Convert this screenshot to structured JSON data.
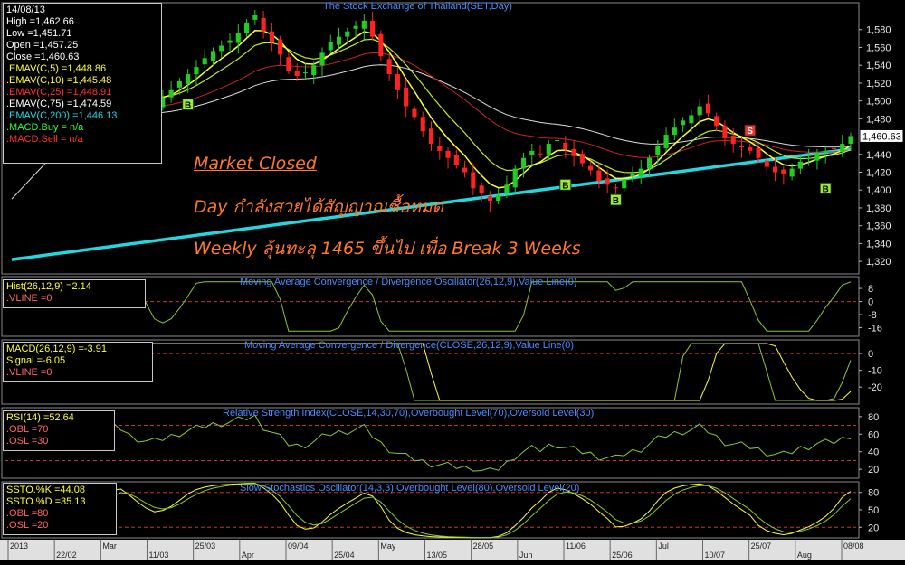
{
  "colors": {
    "bg": "#000000",
    "candle_up": "#22cc22",
    "candle_down": "#ff2222",
    "ema5": "#ffff33",
    "ema10": "#bbee33",
    "ema25": "#cc2222",
    "ema75": "#dddddd",
    "ema200": "#22d8e0",
    "title": "#4a8dff",
    "annotation": "#ff7a2a",
    "dashed_level": "#cc3333"
  },
  "price_info": {
    "date": "14/08/13",
    "high": "High  =1,462.66",
    "low": "Low  =1,451.71",
    "open": "Open  =1,457.25",
    "close": "Close  =1,460.63",
    "ema5": ".EMAV(C,5)  =1,448.86",
    "ema10": ".EMAV(C,10)  =1,445.48",
    "ema25": ".EMAV(C,25)  =1,448.91",
    "ema75": ".EMAV(C,75)  =1,474.59",
    "ema200": ".EMAV(C,200)  =1,446.13",
    "macd_buy": ".MACD.Buy  = n/a",
    "macd_sell": ".MACD.Sell  = n/a"
  },
  "annotations": {
    "line1": "Market Closed",
    "line2": "Day กำลังสวยได้สัญญาณซื้อหมด",
    "line3": "Weekly ลุ้นทะลุ 1465 ขึ้นไป เพื่อ Break 3 Weeks"
  },
  "panels": {
    "price_title": "The Stock Exchange of Thailand(SET,Day)",
    "hist_title": "Moving Average Convergence / Divergence Oscillator(26,12,9),Value Line(0)",
    "hist_info": {
      "hist": "Hist(26,12,9)  =2.14",
      "vline": ".VLINE  =0"
    },
    "macd_title": "Moving Average Convergence / Divergence(CLOSE,26,12,9),Value Line(0)",
    "macd_info": {
      "macd": "MACD(26,12,9)  =-3.91",
      "signal": "Signal  =-6.05",
      "vline": ".VLINE  =0"
    },
    "rsi_title": "Relative Strength Index(CLOSE,14,30,70),Overbought Level(70),Oversold Level(30)",
    "rsi_info": {
      "rsi": "RSI(14)  =52.64",
      "obl": ".OBL  =70",
      "osl": ".OSL  =30"
    },
    "stoch_title": "Slow Stochastics Oscillator(14,3,3),Overbought Level(80),Oversold Level(20)",
    "stoch_info": {
      "k": "SSTO.%K  =44.08",
      "d": "SSTO.%D  =35.13",
      "obl": ".OBL  =80",
      "osl": ".OSL  =20"
    }
  },
  "current_price_label": "1,460.63",
  "signals": [
    "B",
    "B",
    "B",
    "S",
    "B"
  ],
  "chart_data": [
    {
      "type": "candlestick",
      "title": "The Stock Exchange of Thailand(SET,Day)",
      "y_ticks": [
        "1,580",
        "1,560",
        "1,540",
        "1,520",
        "1,500",
        "1,480",
        "1,460",
        "1,440",
        "1,420",
        "1,400",
        "1,380",
        "1,360",
        "1,340",
        "1,320"
      ],
      "ylim": [
        1312,
        1598
      ],
      "x_ticks": [
        "2013",
        "22/02",
        "Mar",
        "11/03",
        "25/03",
        "Apr",
        "09/04",
        "25/04",
        "May",
        "13/05",
        "28/05",
        "Jun",
        "11/06",
        "25/06",
        "Jul",
        "10/07",
        "25/07",
        "Aug",
        "08/08"
      ],
      "close": [
        1462,
        1468,
        1484,
        1492,
        1516,
        1530,
        1498,
        1478,
        1472,
        1496,
        1512,
        1526,
        1534,
        1528,
        1512,
        1504,
        1498,
        1496,
        1504,
        1512,
        1522,
        1530,
        1538,
        1548,
        1556,
        1562,
        1568,
        1576,
        1588,
        1596,
        1578,
        1566,
        1552,
        1534,
        1528,
        1532,
        1540,
        1554,
        1566,
        1572,
        1578,
        1584,
        1590,
        1572,
        1550,
        1530,
        1512,
        1494,
        1482,
        1466,
        1452,
        1444,
        1436,
        1428,
        1420,
        1402,
        1396,
        1388,
        1394,
        1406,
        1424,
        1436,
        1444,
        1440,
        1452,
        1456,
        1446,
        1438,
        1430,
        1422,
        1410,
        1406,
        1402,
        1412,
        1418,
        1424,
        1436,
        1450,
        1462,
        1470,
        1478,
        1484,
        1494,
        1486,
        1472,
        1458,
        1452,
        1448,
        1444,
        1436,
        1426,
        1420,
        1418,
        1424,
        1432,
        1436,
        1442,
        1444,
        1446,
        1452,
        1460.63
      ],
      "markers": [
        {
          "label": "B",
          "index": 21,
          "price": 1496
        },
        {
          "label": "B",
          "index": 66,
          "price": 1406
        },
        {
          "label": "B",
          "index": 72,
          "price": 1389
        },
        {
          "label": "S",
          "index": 88,
          "price": 1467
        },
        {
          "label": "B",
          "index": 97,
          "price": 1402
        }
      ]
    },
    {
      "type": "line",
      "title": "Moving Average Convergence / Divergence Oscillator(26,12,9),Value Line(0)",
      "y_ticks": [
        "8",
        "0",
        "-8",
        "-16"
      ],
      "ylim": [
        -19,
        13
      ],
      "hist_value": 2.14
    },
    {
      "type": "line",
      "title": "Moving Average Convergence / Divergence(CLOSE,26,12,9),Value Line(0)",
      "y_ticks": [
        "0",
        "-10",
        "-20"
      ],
      "ylim": [
        -28,
        6
      ],
      "macd_last": -3.91,
      "signal_last": -6.05
    },
    {
      "type": "line",
      "title": "Relative Strength Index(CLOSE,14,30,70),Overbought Level(70),Oversold Level(30)",
      "y_ticks": [
        "80",
        "60",
        "40",
        "20"
      ],
      "ylim": [
        14,
        86
      ],
      "rsi_last": 52.64,
      "levels": [
        70,
        30
      ]
    },
    {
      "type": "line",
      "title": "Slow Stochastics Oscillator(14,3,3),Overbought Level(80),Oversold Level(20)",
      "y_ticks": [
        "80",
        "50",
        "20"
      ],
      "ylim": [
        8,
        92
      ],
      "k_last": 44.08,
      "d_last": 35.13,
      "levels": [
        80,
        20
      ]
    }
  ]
}
